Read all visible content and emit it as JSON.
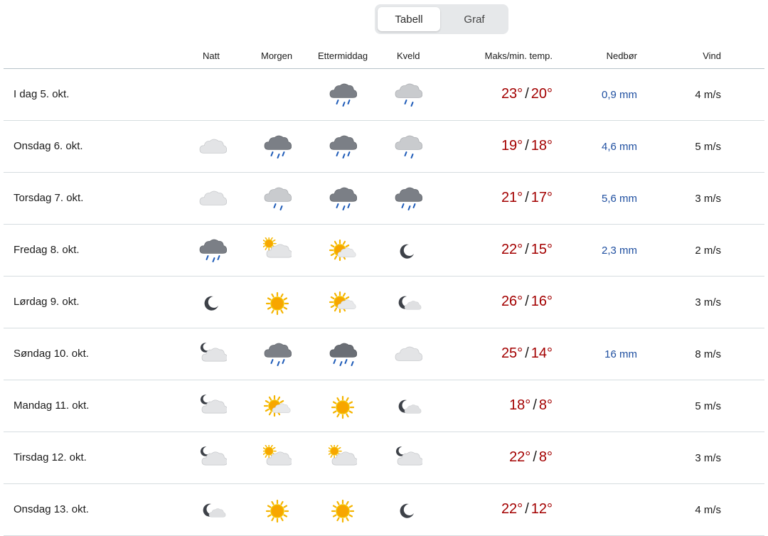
{
  "toggle": {
    "table_label": "Tabell",
    "graph_label": "Graf",
    "selected": "Tabell"
  },
  "headers": {
    "night": "Natt",
    "morning": "Morgen",
    "afternoon": "Ettermiddag",
    "evening": "Kveld",
    "temp": "Maks/min. temp.",
    "precip": "Nedbør",
    "wind": "Vind"
  },
  "colors": {
    "temp": "#a30000",
    "precip": "#1f4fa0",
    "divider": "#d6dde0"
  },
  "rows": [
    {
      "date": "I dag 5. okt.",
      "night": null,
      "morning": null,
      "afternoon": "rain-cloud",
      "evening": "light-rain-cloud",
      "max": "23°",
      "min": "20°",
      "precip": "0,9 mm",
      "wind": "4 m/s"
    },
    {
      "date": "Onsdag 6. okt.",
      "night": "cloud",
      "morning": "rain-cloud",
      "afternoon": "rain-cloud",
      "evening": "light-rain-cloud",
      "max": "19°",
      "min": "18°",
      "precip": "4,6 mm",
      "wind": "5 m/s"
    },
    {
      "date": "Torsdag 7. okt.",
      "night": "cloud",
      "morning": "light-rain-cloud",
      "afternoon": "rain-cloud",
      "evening": "rain-cloud",
      "max": "21°",
      "min": "17°",
      "precip": "5,6 mm",
      "wind": "3 m/s"
    },
    {
      "date": "Fredag 8. okt.",
      "night": "rain-cloud",
      "morning": "partly-cloudy-day",
      "afternoon": "fair-day",
      "evening": "moon",
      "max": "22°",
      "min": "15°",
      "precip": "2,3 mm",
      "wind": "2 m/s"
    },
    {
      "date": "Lørdag 9. okt.",
      "night": "moon",
      "morning": "sun",
      "afternoon": "fair-day",
      "evening": "fair-night",
      "max": "26°",
      "min": "16°",
      "precip": "",
      "wind": "3 m/s"
    },
    {
      "date": "Søndag 10. okt.",
      "night": "partly-cloudy-night",
      "morning": "rain-cloud",
      "afternoon": "heavy-rain-cloud",
      "evening": "cloud",
      "max": "25°",
      "min": "14°",
      "precip": "16 mm",
      "wind": "8 m/s"
    },
    {
      "date": "Mandag 11. okt.",
      "night": "partly-cloudy-night",
      "morning": "fair-day",
      "afternoon": "sun",
      "evening": "fair-night",
      "max": "18°",
      "min": "8°",
      "precip": "",
      "wind": "5 m/s"
    },
    {
      "date": "Tirsdag 12. okt.",
      "night": "partly-cloudy-night",
      "morning": "partly-cloudy-day",
      "afternoon": "partly-cloudy-day",
      "evening": "partly-cloudy-night",
      "max": "22°",
      "min": "8°",
      "precip": "",
      "wind": "3 m/s"
    },
    {
      "date": "Onsdag 13. okt.",
      "night": "fair-night",
      "morning": "sun",
      "afternoon": "sun",
      "evening": "moon",
      "max": "22°",
      "min": "12°",
      "precip": "",
      "wind": "4 m/s"
    }
  ]
}
